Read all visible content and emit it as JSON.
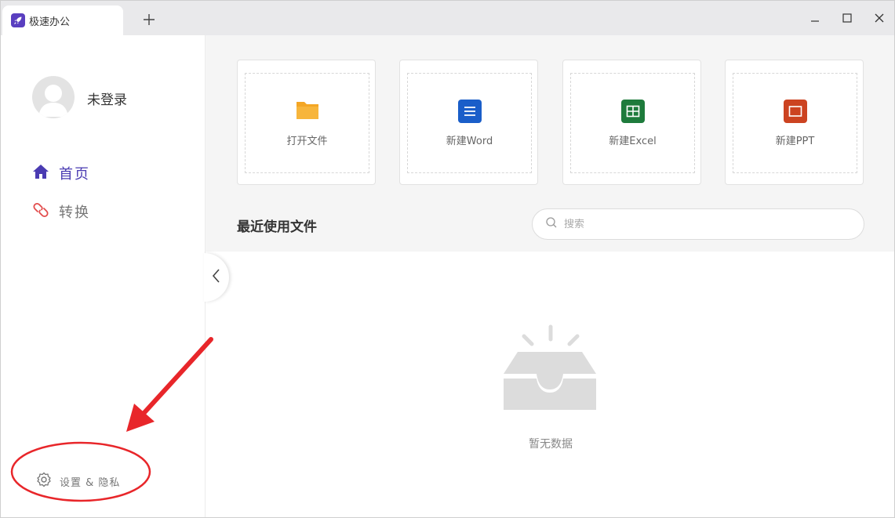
{
  "app": {
    "title": "极速办公"
  },
  "user": {
    "name": "未登录"
  },
  "sidebar": {
    "items": [
      {
        "label": "首页",
        "icon": "home-icon"
      },
      {
        "label": "转换",
        "icon": "convert-icon"
      }
    ],
    "settings_label": "设置 & 隐私"
  },
  "actions": [
    {
      "label": "打开文件",
      "icon": "folder-icon",
      "color": "#f4a624"
    },
    {
      "label": "新建Word",
      "icon": "word-icon",
      "color": "#1a5ec9"
    },
    {
      "label": "新建Excel",
      "icon": "excel-icon",
      "color": "#1e7b3c"
    },
    {
      "label": "新建PPT",
      "icon": "ppt-icon",
      "color": "#cc4321"
    }
  ],
  "recent": {
    "title": "最近使用文件",
    "search_placeholder": "搜索",
    "empty_text": "暂无数据"
  },
  "colors": {
    "accent": "#4a3bb2",
    "annotation": "#e8262a"
  }
}
